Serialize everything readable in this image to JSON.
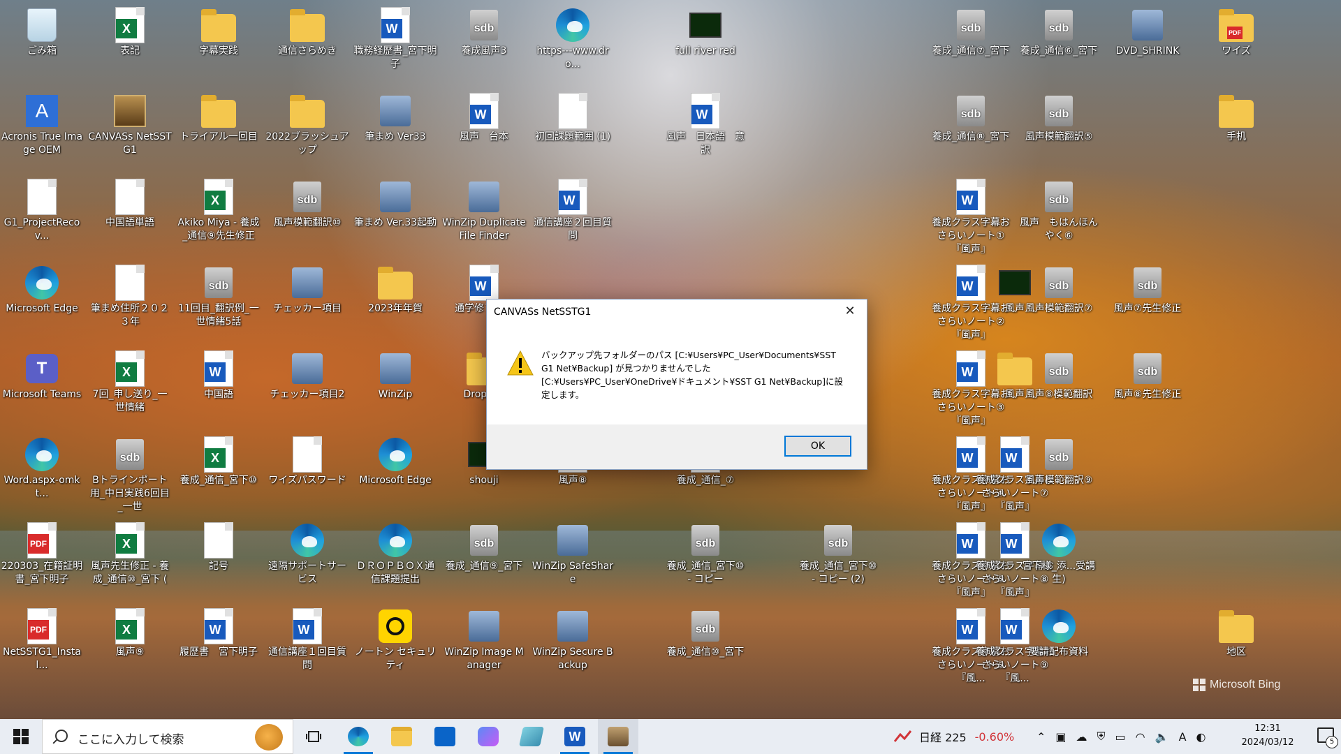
{
  "desktop": {
    "icons": [
      {
        "label": "ごみ箱",
        "type": "recycle"
      },
      {
        "label": "表記",
        "type": "excel"
      },
      {
        "label": "字幕実践",
        "type": "folder"
      },
      {
        "label": "通信さらめき",
        "type": "folder"
      },
      {
        "label": "職務経歴書_宮下明子",
        "type": "word"
      },
      {
        "label": "養成風声3",
        "type": "sdb"
      },
      {
        "label": "https---www.dro...",
        "type": "edge"
      },
      {
        "label": "full river red",
        "type": "video"
      },
      {
        "label": "養成_通信⑦_宮下",
        "type": "sdb"
      },
      {
        "label": "養成_通信⑥_宮下",
        "type": "sdb"
      },
      {
        "label": "DVD_SHRINK",
        "type": "app"
      },
      {
        "label": "ワイズ",
        "type": "pdf-folder"
      },
      {
        "label": "Acronis True Image OEM",
        "type": "acronis"
      },
      {
        "label": "CANVASs NetSSTG1",
        "type": "canvas"
      },
      {
        "label": "トライアル一回目",
        "type": "folder"
      },
      {
        "label": "2022ブラッシュアップ",
        "type": "folder"
      },
      {
        "label": "筆まめ Ver33",
        "type": "app"
      },
      {
        "label": "風声　台本",
        "type": "word"
      },
      {
        "label": "初回課題範囲 (1)",
        "type": "doc"
      },
      {
        "label": "風声　日本語　意訳",
        "type": "word"
      },
      {
        "label": "養成_通信⑧_宮下",
        "type": "sdb"
      },
      {
        "label": "風声模範翻訳⑤",
        "type": "sdb"
      },
      {
        "label": "手机",
        "type": "folder"
      },
      {
        "label": "G1_ProjectRecov...",
        "type": "doc"
      },
      {
        "label": "中国語単語",
        "type": "doc"
      },
      {
        "label": "Akiko Miya - 養成_通信⑨先生修正",
        "type": "excel"
      },
      {
        "label": "風声模範翻訳⑩",
        "type": "sdb"
      },
      {
        "label": "筆まめ Ver.33起動",
        "type": "app"
      },
      {
        "label": "WinZip Duplicate File Finder",
        "type": "app"
      },
      {
        "label": "通信講座２回目質問",
        "type": "word"
      },
      {
        "label": "養成クラス字幕おさらいノート①『風声』",
        "type": "word"
      },
      {
        "label": "風声　もはんほんやく⑥",
        "type": "sdb"
      },
      {
        "label": "Microsoft Edge",
        "type": "edge"
      },
      {
        "label": "筆まめ住所２０２３年",
        "type": "doc"
      },
      {
        "label": "11回目_翻訳例_一世情緒5話",
        "type": "sdb"
      },
      {
        "label": "チェッカー項目",
        "type": "app"
      },
      {
        "label": "2023年年賀",
        "type": "folder"
      },
      {
        "label": "通学修了資料",
        "type": "word"
      },
      {
        "label": "養成クラス字幕おさらいノート②『風声』",
        "type": "word"
      },
      {
        "label": "風声",
        "type": "video"
      },
      {
        "label": "風声模範翻訳⑦",
        "type": "sdb"
      },
      {
        "label": "風声⑦先生修正",
        "type": "sdb"
      },
      {
        "label": "Microsoft Teams",
        "type": "teams"
      },
      {
        "label": "7回_申し送り_一世情緒",
        "type": "excel"
      },
      {
        "label": "中国語",
        "type": "word"
      },
      {
        "label": "チェッカー項目2",
        "type": "app"
      },
      {
        "label": "WinZip",
        "type": "app"
      },
      {
        "label": "Dropbox",
        "type": "folder"
      },
      {
        "label": "養成クラス字幕おさらいノート③『風声』",
        "type": "word"
      },
      {
        "label": "風声",
        "type": "folder"
      },
      {
        "label": "風声⑧模範翻訳",
        "type": "sdb"
      },
      {
        "label": "風声⑧先生修正",
        "type": "sdb"
      },
      {
        "label": "Word.aspx-omkt...",
        "type": "edge"
      },
      {
        "label": "Bトラインポート用_中日実践6回目_一世",
        "type": "sdb"
      },
      {
        "label": "養成_通信_宮下⑩",
        "type": "excel"
      },
      {
        "label": "ワイズパスワード",
        "type": "doc"
      },
      {
        "label": "Microsoft Edge",
        "type": "edge"
      },
      {
        "label": "shouji",
        "type": "video"
      },
      {
        "label": "風声⑧",
        "type": "doc"
      },
      {
        "label": "養成_通信_⑦",
        "type": "doc"
      },
      {
        "label": "養成クラス字幕おさらいノート④『風声』",
        "type": "word"
      },
      {
        "label": "養成クラス字幕おさらいノート⑦『風声』",
        "type": "word"
      },
      {
        "label": "風声模範翻訳⑨",
        "type": "sdb"
      },
      {
        "label": "220303_在籍証明書_宮下明子",
        "type": "pdf"
      },
      {
        "label": "風声先生修正 - 養成_通信⑩_宮下 (",
        "type": "excel"
      },
      {
        "label": "記号",
        "type": "doc"
      },
      {
        "label": "遠隔サポートサービス",
        "type": "edge"
      },
      {
        "label": "ＤＲＯＰＢＯＸ通信課題提出",
        "type": "edge"
      },
      {
        "label": "養成_通信⑨_宮下",
        "type": "sdb"
      },
      {
        "label": "WinZip SafeShare",
        "type": "app"
      },
      {
        "label": "養成_通信_宮下⑩ - コピー",
        "type": "sdb"
      },
      {
        "label": "養成_通信_宮下⑩ - コピー (2)",
        "type": "sdb"
      },
      {
        "label": "養成クラス字幕おさらいノート⑤『風声』",
        "type": "word"
      },
      {
        "label": "養成クラス字幕おさらいノート⑧『風声』",
        "type": "word"
      },
      {
        "label": "宮下様_添...受講生)",
        "type": "edge"
      },
      {
        "label": "NetSSTG1_Instal...",
        "type": "pdf"
      },
      {
        "label": "風声⑨",
        "type": "excel"
      },
      {
        "label": "履歴書　宮下明子",
        "type": "word"
      },
      {
        "label": "通信講座１回目質問",
        "type": "word"
      },
      {
        "label": "ノートン セキュリティ",
        "type": "norton"
      },
      {
        "label": "WinZip Image Manager",
        "type": "app"
      },
      {
        "label": "WinZip Secure Backup",
        "type": "app"
      },
      {
        "label": "養成_通信⑩_宮下",
        "type": "sdb"
      },
      {
        "label": "養成クラス字幕おさらいノート⑥『風...",
        "type": "word"
      },
      {
        "label": "養成クラス字幕おさらいノート⑨『風...",
        "type": "word"
      },
      {
        "label": "要請配布資料",
        "type": "edge"
      },
      {
        "label": "地区",
        "type": "folder"
      }
    ]
  },
  "dialog": {
    "title": "CANVASs NetSSTG1",
    "message_line1": "バックアップ先フォルダーのパス [C:¥Users¥PC_User¥Documents¥SST G1 Net¥Backup] が見つかりませんでした",
    "message_line2": "[C:¥Users¥PC_User¥OneDrive¥ドキュメント¥SST G1 Net¥Backup]に設定します。",
    "ok_label": "OK",
    "close_symbol": "✕"
  },
  "watermark": {
    "text": "Microsoft Bing"
  },
  "taskbar": {
    "search_placeholder": "ここに入力して検索",
    "stock_label": "日経 225",
    "stock_change": "-0.60%",
    "ime_label": "A",
    "time": "12:31",
    "date": "2024/03/12",
    "notification_count": "5",
    "colors": {
      "stock_negative": "#d13438",
      "accent": "#0078d7"
    }
  }
}
